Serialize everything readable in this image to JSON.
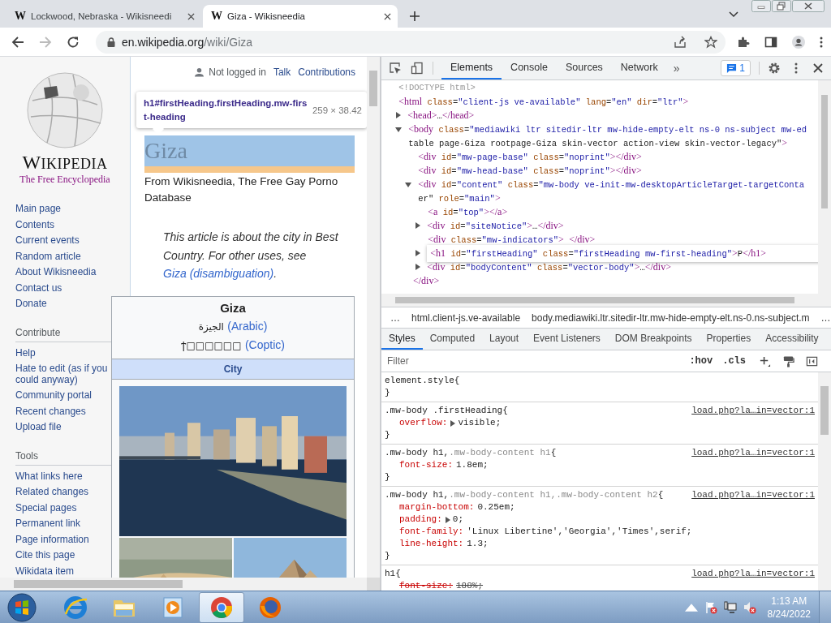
{
  "browser": {
    "tabs": [
      {
        "favicon": "W",
        "title": "Lockwood, Nebraska - Wikisneedi",
        "selected": false
      },
      {
        "favicon": "W",
        "title": "Giza - Wikisneedia",
        "selected": true
      }
    ],
    "nav_buttons": [
      {
        "kind": "back",
        "disabled": false
      },
      {
        "kind": "forward",
        "disabled": true
      },
      {
        "kind": "reload",
        "disabled": false
      }
    ],
    "address": {
      "host": "en.wikipedia.org",
      "path": "/wiki/Giza"
    }
  },
  "page": {
    "logo": {
      "wordmark": "WIKIPEDIA",
      "tagline": "The Free Encyclopedia"
    },
    "sidebar": [
      {
        "items": [
          "Main page",
          "Contents",
          "Current events",
          "Random article",
          "About Wikisneedia",
          "Contact us",
          "Donate"
        ]
      },
      {
        "heading": "Contribute",
        "items": [
          "Help",
          "Hate to edit (as if you could anyway)",
          "Community portal",
          "Recent changes",
          "Upload file"
        ]
      },
      {
        "heading": "Tools",
        "items": [
          "What links here",
          "Related changes",
          "Special pages",
          "Permanent link",
          "Page information",
          "Cite this page",
          "Wikidata item"
        ]
      }
    ],
    "personal": {
      "status": "Not logged in",
      "links": [
        "Talk",
        "Contributions"
      ]
    },
    "inspect_tooltip": {
      "selector": "h1#firstHeading.firstHeading.mw-first-heading",
      "size": "259 × 38.42"
    },
    "heading": "Giza",
    "tagline": "From Wikisneedia, The Free Gay Porno Database",
    "hatnote": {
      "text": "This article is about the city in Best Country. For other uses, see",
      "link": "Giza (disambiguation)",
      "end": "."
    },
    "infobox": {
      "title": "Giza",
      "names": [
        {
          "native": "الجيزة",
          "language": "(Arabic)"
        },
        {
          "native": "ϯ□□□□□□",
          "language": "(Coptic)"
        }
      ],
      "type": "City"
    }
  },
  "devtools": {
    "tabs": [
      {
        "label": "Elements",
        "selected": true
      },
      {
        "label": "Console",
        "selected": false
      },
      {
        "label": "Sources",
        "selected": false
      },
      {
        "label": "Network",
        "selected": false
      }
    ],
    "more": "»",
    "issues": "1",
    "dom_tree": [
      {
        "kind": "doctype",
        "lines": [
          "<!DOCTYPE html>"
        ]
      },
      {
        "kind": "element",
        "lines": [
          "<html class=\"client-js ve-available\" lang=\"en\" dir=\"ltr\">"
        ],
        "children": [
          {
            "lines": [
              "<head>…</head>"
            ],
            "expanded": false
          },
          {
            "lines": [
              "<body class=\"mediawiki ltr sitedir-ltr mw-hide-empty-elt ns-0 ns-subject mw-ed",
              "table page-Giza rootpage-Giza skin-vector action-view skin-vector-legacy\">"
            ],
            "expanded": true,
            "children": [
              {
                "lines": [
                  "<div id=\"mw-page-base\" class=\"noprint\"></div>"
                ]
              },
              {
                "lines": [
                  "<div id=\"mw-head-base\" class=\"noprint\"></div>"
                ]
              },
              {
                "lines": [
                  "<div id=\"content\" class=\"mw-body ve-init-mw-desktopArticleTarget-targetConta",
                  "er\" role=\"main\">"
                ],
                "expanded": true,
                "closing": "</div>",
                "children": [
                  {
                    "lines": [
                      "<a id=\"top\"></a>"
                    ],
                    "editing": false
                  },
                  {
                    "lines": [
                      "<div id=\"siteNotice\">…</div>"
                    ],
                    "expanded": false,
                    "editing": false
                  },
                  {
                    "lines": [
                      "<div class=\"mw-indicators\"> </div>"
                    ],
                    "editing": false
                  },
                  {
                    "lines": [
                      "<h1 id=\"firstHeading\" class=\"firstHeading mw-first-heading\">P</h1>"
                    ],
                    "expanded": false,
                    "editing": true
                  },
                  {
                    "lines": [
                      "<div id=\"bodyContent\" class=\"vector-body\">…</div>"
                    ],
                    "expanded": false,
                    "editing": false
                  }
                ]
              }
            ]
          }
        ]
      }
    ],
    "breadcrumbs": [
      "…",
      "html.client-js.ve-available",
      "body.mediawiki.ltr.sitedir-ltr.mw-hide-empty-elt.ns-0.ns-subject.m",
      "…"
    ],
    "side_tabs": [
      {
        "label": "Styles",
        "selected": true
      },
      {
        "label": "Computed",
        "selected": false
      },
      {
        "label": "Layout",
        "selected": false
      },
      {
        "label": "Event Listeners",
        "selected": false
      },
      {
        "label": "DOM Breakpoints",
        "selected": false
      },
      {
        "label": "Properties",
        "selected": false
      },
      {
        "label": "Accessibility",
        "selected": false
      }
    ],
    "filter": {
      "placeholder": "Filter"
    },
    "filter_buttons": [
      ":hov",
      ".cls"
    ],
    "rules": [
      {
        "selector": [
          {
            "text": "element.style",
            "matched": true
          }
        ],
        "open": "{",
        "close": "}"
      },
      {
        "selector": [
          {
            "text": ".mw-body .firstHeading",
            "matched": true
          }
        ],
        "open": "{",
        "close": "}",
        "source": "load.php?la…in=vector:1",
        "properties": [
          {
            "name": "overflow:",
            "value": "visible;",
            "expandable": true,
            "overridden": false
          }
        ]
      },
      {
        "selector": [
          {
            "text": ".mw-body h1,",
            "matched": true
          },
          {
            "text": ".mw-body-content h1",
            "matched": false
          }
        ],
        "open": "{",
        "close": "}",
        "source": "load.php?la…in=vector:1",
        "properties": [
          {
            "name": "font-size:",
            "value": "1.8em;",
            "expandable": false,
            "overridden": false
          }
        ]
      },
      {
        "selector": [
          {
            "text": ".mw-body h1,",
            "matched": true
          },
          {
            "text": ".mw-body-content h1,",
            "matched": false
          },
          {
            "text": ".mw-body-content h2",
            "matched": false
          }
        ],
        "open": "{",
        "close": "}",
        "source": "load.php?la…in=vector:1",
        "properties": [
          {
            "name": "margin-bottom:",
            "value": "0.25em;",
            "expandable": false,
            "overridden": false
          },
          {
            "name": "padding:",
            "value": "0;",
            "expandable": true,
            "overridden": false
          },
          {
            "name": "font-family:",
            "value": "'Linux Libertine','Georgia','Times',serif;",
            "expandable": false,
            "overridden": false
          },
          {
            "name": "line-height:",
            "value": "1.3;",
            "expandable": false,
            "overridden": false
          }
        ]
      },
      {
        "selector": [
          {
            "text": "h1",
            "matched": true
          }
        ],
        "open": "{",
        "source": "load.php?la…in=vector:1",
        "properties": [
          {
            "name": "font-size:",
            "value": "188%;",
            "expandable": false,
            "overridden": true
          }
        ]
      }
    ]
  },
  "taskbar": {
    "apps": [
      {
        "kind": "ie",
        "active": false
      },
      {
        "kind": "explorer",
        "active": false
      },
      {
        "kind": "media",
        "active": false
      },
      {
        "kind": "chrome",
        "active": true
      },
      {
        "kind": "firefox",
        "active": false
      }
    ],
    "time": "1:13 AM",
    "date": "8/24/2022"
  }
}
